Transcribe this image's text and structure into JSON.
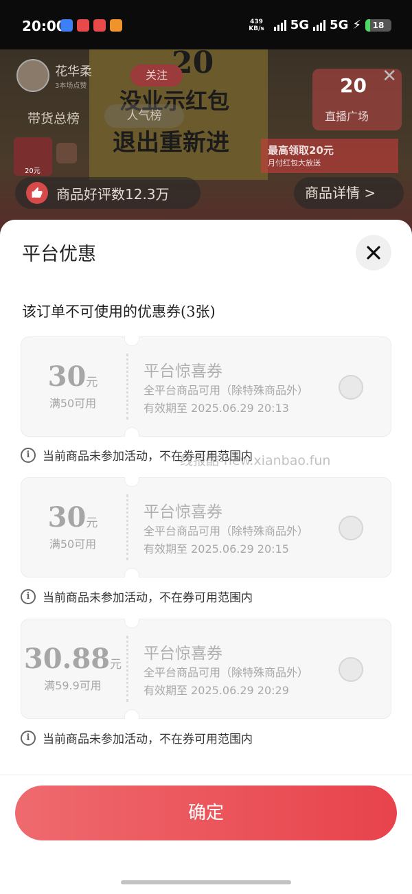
{
  "status_bar": {
    "time": "20:00",
    "net_speed_value": "439",
    "net_speed_unit": "KB/s",
    "sim1": "5G",
    "sim2": "5G",
    "battery": "18",
    "app_icon_colors": [
      "#3d7ff5",
      "#e84a4a",
      "#e84a4a",
      "#f0932b"
    ]
  },
  "live_background": {
    "host_name": "花华柔",
    "host_sub": "3本场点赞",
    "follow_label": "关注",
    "rank_label": "带货总榜",
    "popular_label": "人气榜",
    "board_line1": "没业示红包",
    "board_line2": "退出重新进",
    "board_top": "20",
    "live_square_count": "20",
    "live_square_label": "直播广场",
    "gift_main": "最高领取20元",
    "gift_sub": "月付红包大放送",
    "thumb_price": "20元",
    "review_label": "商品好评数12.3万",
    "detail_label": "商品详情 >"
  },
  "sheet": {
    "title": "平台优惠",
    "section_title": "该订单不可使用的优惠券(3张)",
    "watermark": "线报酷-new.xianbao.fun",
    "confirm_label": "确定",
    "coupons": [
      {
        "amount": "30",
        "unit": "元",
        "condition": "满50可用",
        "name": "平台惊喜券",
        "scope": "全平台商品可用（除特殊商品外）",
        "expiry": "有效期至 2025.06.29 20:13",
        "notice": "当前商品未参加活动，不在券可用范围内"
      },
      {
        "amount": "30",
        "unit": "元",
        "condition": "满50可用",
        "name": "平台惊喜券",
        "scope": "全平台商品可用（除特殊商品外）",
        "expiry": "有效期至 2025.06.29 20:15",
        "notice": "当前商品未参加活动，不在券可用范围内"
      },
      {
        "amount": "30.88",
        "unit": "元",
        "condition": "满59.9可用",
        "name": "平台惊喜券",
        "scope": "全平台商品可用（除特殊商品外）",
        "expiry": "有效期至 2025.06.29 20:29",
        "notice": "当前商品未参加活动，不在券可用范围内"
      }
    ]
  },
  "colors": {
    "accent": "#e8434c",
    "coupon_bg": "#f7f7f7",
    "muted_text": "#a6a6a6"
  }
}
